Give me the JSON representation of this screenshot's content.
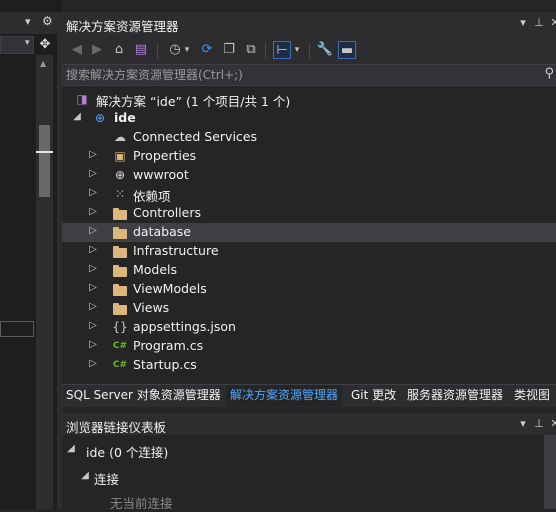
{
  "left": {
    "pin_icon": "pin-icon",
    "gear_icon": "gear-icon"
  },
  "panel": {
    "title": "解决方案资源管理器",
    "title_icons": [
      "dropdown-arrow-icon",
      "pin-icon",
      "close-icon"
    ]
  },
  "toolbar": {
    "tools": [
      "back-icon",
      "forward-icon",
      "home-icon",
      "vs-switch-icon",
      "history-icon",
      "sync-icon",
      "collapse-all-icon",
      "show-all-files-icon",
      "view-toggle-icon",
      "properties-wrench-icon",
      "preview-icon"
    ]
  },
  "search": {
    "placeholder": "搜索解决方案资源管理器(Ctrl+;)"
  },
  "tree": {
    "solution_label": "解决方案 “ide” (1 个项目/共 1 个)",
    "project_label": "ide",
    "items": [
      {
        "label": "Connected Services",
        "icon": "connected-services-icon"
      },
      {
        "label": "Properties",
        "icon": "properties-icon"
      },
      {
        "label": "wwwroot",
        "icon": "globe-icon"
      },
      {
        "label": "依赖项",
        "icon": "dependencies-icon"
      },
      {
        "label": "Controllers",
        "icon": "folder-icon"
      },
      {
        "label": "database",
        "icon": "folder-icon"
      },
      {
        "label": "Infrastructure",
        "icon": "folder-icon"
      },
      {
        "label": "Models",
        "icon": "folder-icon"
      },
      {
        "label": "ViewModels",
        "icon": "folder-icon"
      },
      {
        "label": "Views",
        "icon": "folder-icon"
      },
      {
        "label": "appsettings.json",
        "icon": "json-file-icon"
      },
      {
        "label": "Program.cs",
        "icon": "csharp-file-icon"
      },
      {
        "label": "Startup.cs",
        "icon": "csharp-file-icon"
      }
    ]
  },
  "tabs": [
    {
      "label": "SQL Server 对象资源管理器"
    },
    {
      "label": "解决方案资源管理器"
    },
    {
      "label": "Git 更改"
    },
    {
      "label": "服务器资源管理器"
    },
    {
      "label": "类视图"
    }
  ],
  "bottom": {
    "title": "浏览器链接仪表板",
    "connection_label": "ide (0 个连接)",
    "connections_header": "连接",
    "no_connection": "无当前连接"
  },
  "glyphs": {
    "csharp": "C#"
  }
}
